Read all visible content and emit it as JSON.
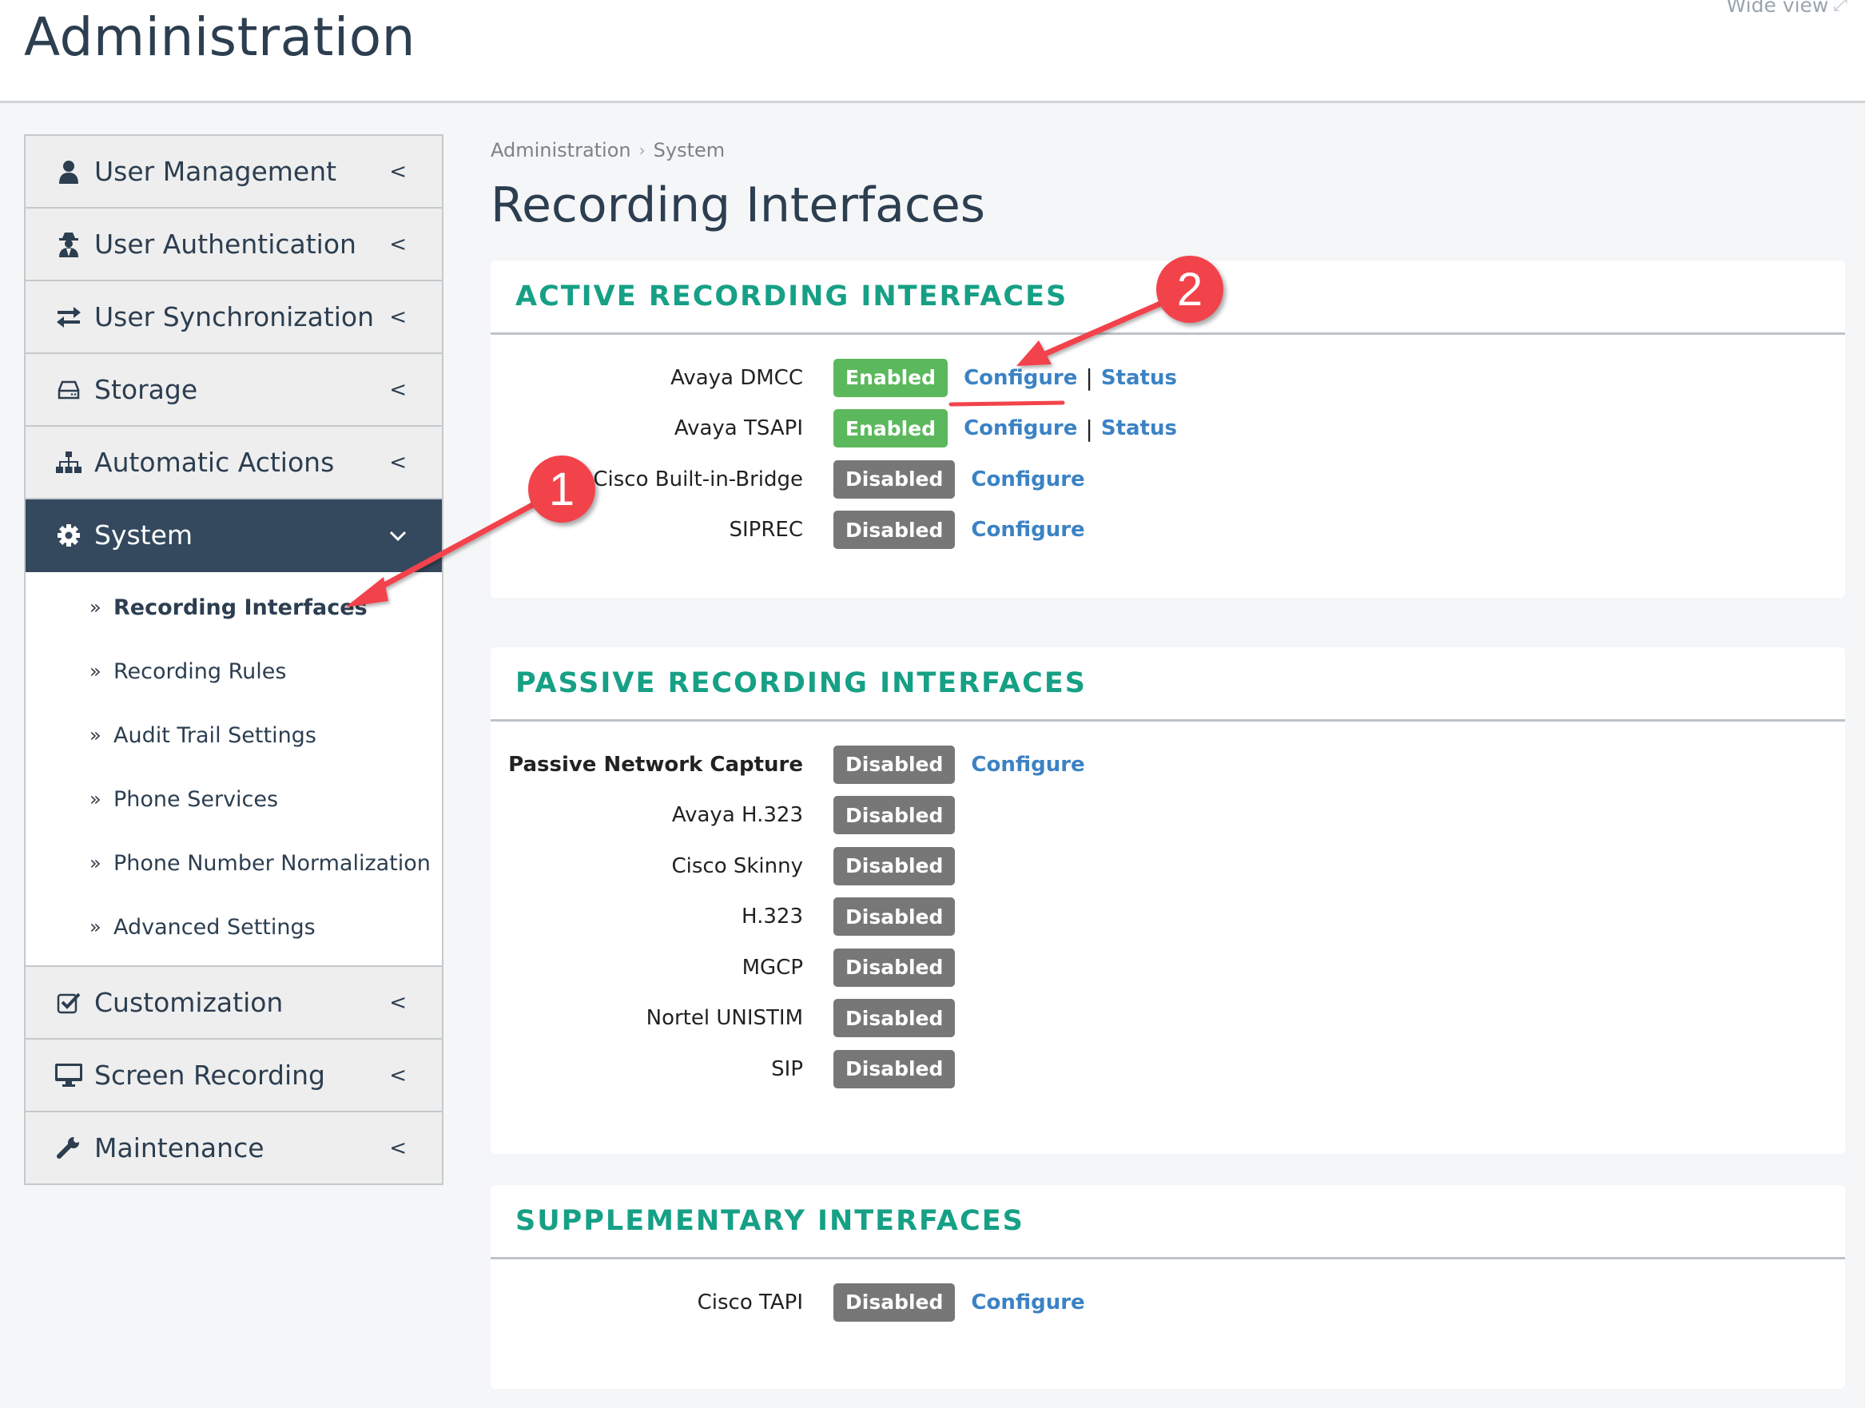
{
  "header": {
    "title": "Administration",
    "wide_view_label": "Wide view"
  },
  "sidebar": {
    "items": [
      {
        "label": "User Management",
        "icon": "user-icon"
      },
      {
        "label": "User Authentication",
        "icon": "spy-icon"
      },
      {
        "label": "User Synchronization",
        "icon": "exchange-icon"
      },
      {
        "label": "Storage",
        "icon": "hdd-icon"
      },
      {
        "label": "Automatic Actions",
        "icon": "sitemap-icon"
      },
      {
        "label": "System",
        "icon": "gear-icon",
        "active": true
      },
      {
        "label": "Customization",
        "icon": "check-square-icon"
      },
      {
        "label": "Screen Recording",
        "icon": "desktop-icon"
      },
      {
        "label": "Maintenance",
        "icon": "wrench-icon"
      }
    ],
    "system_submenu": [
      {
        "label": "Recording Interfaces",
        "current": true
      },
      {
        "label": "Recording Rules"
      },
      {
        "label": "Audit Trail Settings"
      },
      {
        "label": "Phone Services"
      },
      {
        "label": "Phone Number Normalization"
      },
      {
        "label": "Advanced Settings"
      }
    ]
  },
  "breadcrumb": [
    "Administration",
    "System"
  ],
  "page_title": "Recording Interfaces",
  "link_labels": {
    "configure": "Configure",
    "status": "Status",
    "separator": "|"
  },
  "sections": {
    "active": {
      "title": "ACTIVE RECORDING INTERFACES",
      "rows": [
        {
          "name": "Avaya DMCC",
          "status": "Enabled",
          "links": [
            "Configure",
            "Status"
          ]
        },
        {
          "name": "Avaya TSAPI",
          "status": "Enabled",
          "links": [
            "Configure",
            "Status"
          ]
        },
        {
          "name": "Cisco Built-in-Bridge",
          "status": "Disabled",
          "links": [
            "Configure"
          ]
        },
        {
          "name": "SIPREC",
          "status": "Disabled",
          "links": [
            "Configure"
          ]
        }
      ]
    },
    "passive": {
      "title": "PASSIVE RECORDING INTERFACES",
      "rows": [
        {
          "name": "Passive Network Capture",
          "status": "Disabled",
          "links": [
            "Configure"
          ],
          "bold": true
        },
        {
          "name": "Avaya H.323",
          "status": "Disabled",
          "links": []
        },
        {
          "name": "Cisco Skinny",
          "status": "Disabled",
          "links": []
        },
        {
          "name": "H.323",
          "status": "Disabled",
          "links": []
        },
        {
          "name": "MGCP",
          "status": "Disabled",
          "links": []
        },
        {
          "name": "Nortel UNISTIM",
          "status": "Disabled",
          "links": []
        },
        {
          "name": "SIP",
          "status": "Disabled",
          "links": []
        }
      ]
    },
    "supplementary": {
      "title": "SUPPLEMENTARY INTERFACES",
      "rows": [
        {
          "name": "Cisco TAPI",
          "status": "Disabled",
          "links": [
            "Configure"
          ]
        }
      ]
    }
  },
  "annotations": {
    "callout_1": "1",
    "callout_2": "2"
  },
  "colors": {
    "accent_teal": "#16a085",
    "enabled_green": "#5cb85c",
    "disabled_gray": "#777777",
    "link_blue": "#3b82c4",
    "nav_active": "#34495e",
    "annotation_red": "#f2434b"
  }
}
